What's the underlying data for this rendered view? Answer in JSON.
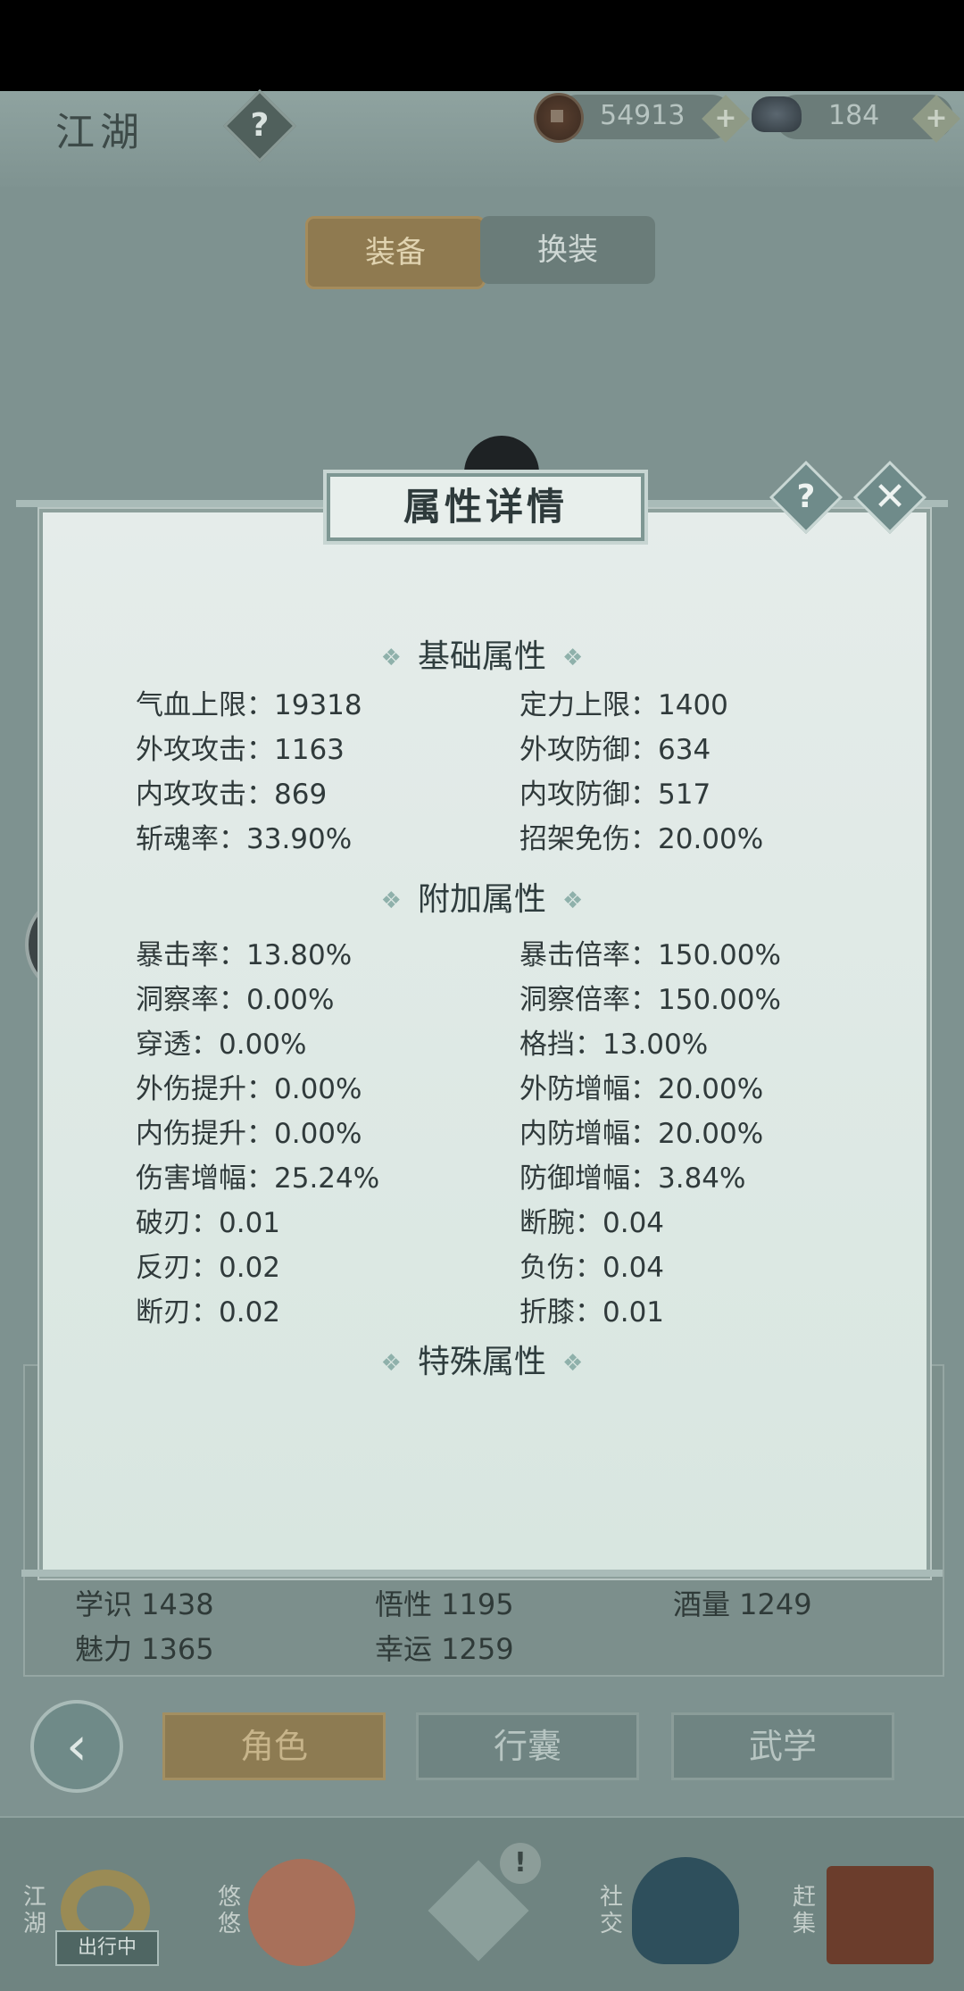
{
  "header": {
    "title": "江湖",
    "help_icon": "question-icon",
    "copper": "54913",
    "silver": "184",
    "plus": "+"
  },
  "tabs": {
    "equip": "装备",
    "swap": "换装"
  },
  "modal": {
    "title": "属性详情",
    "help": "?",
    "close": "✕",
    "sections": {
      "basic": "基础属性",
      "extra": "附加属性",
      "special": "特殊属性"
    },
    "basic_stats": [
      [
        "气血上限：19318",
        "定力上限：1400"
      ],
      [
        "外攻攻击：1163",
        "外攻防御：634"
      ],
      [
        "内攻攻击：869",
        "内攻防御：517"
      ],
      [
        "斩魂率：33.90%",
        "招架免伤：20.00%"
      ]
    ],
    "extra_stats": [
      [
        "暴击率：13.80%",
        "暴击倍率：150.00%"
      ],
      [
        "洞察率：0.00%",
        "洞察倍率：150.00%"
      ],
      [
        "穿透：0.00%",
        "格挡：13.00%"
      ],
      [
        "外伤提升：0.00%",
        "外防增幅：20.00%"
      ],
      [
        "内伤提升：0.00%",
        "内防增幅：20.00%"
      ],
      [
        "伤害增幅：25.24%",
        "防御增幅：3.84%"
      ],
      [
        "破刃：0.01",
        "断腕：0.04"
      ],
      [
        "反刃：0.02",
        "负伤：0.04"
      ],
      [
        "断刃：0.02",
        "折膝：0.01"
      ]
    ]
  },
  "background_stats": {
    "xueshi": "学识 1438",
    "wuxing": "悟性 1195",
    "jiuliang": "酒量 1249",
    "meili": "魅力 1365",
    "xingyun": "幸运 1259"
  },
  "bottom_buttons": {
    "role": "角色",
    "bag": "行囊",
    "martial": "武学"
  },
  "nav": {
    "jianghu": "江湖",
    "in_progress": "出行中",
    "youyou": "悠悠",
    "shejiao": "社交",
    "ganji": "赶集",
    "alert": "!"
  }
}
